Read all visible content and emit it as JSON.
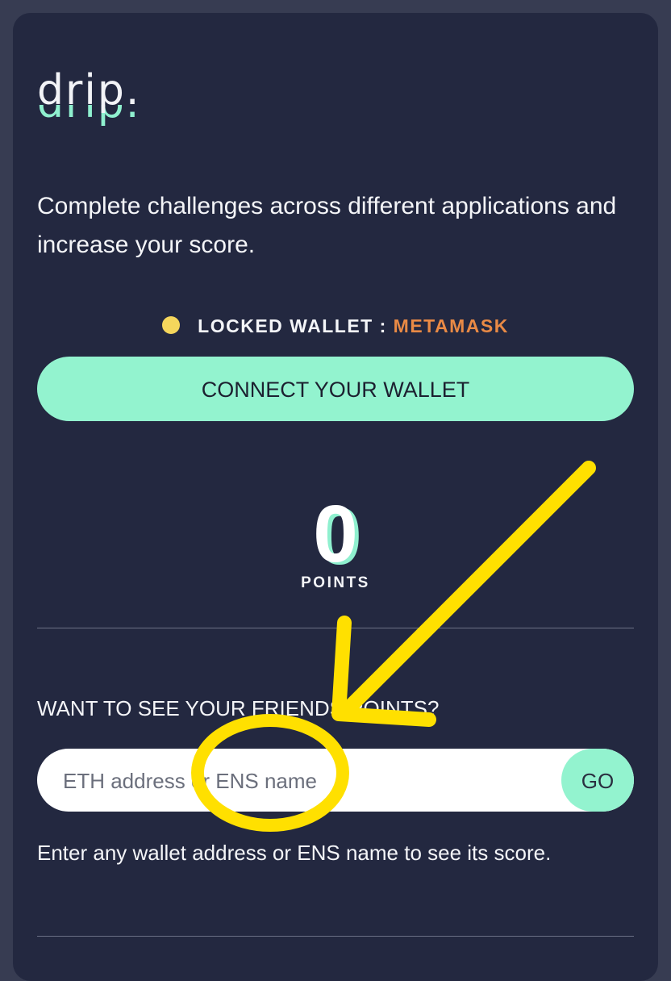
{
  "brand": {
    "logo_text": "drip."
  },
  "intro": {
    "text": "Complete challenges across different applications and increase your score."
  },
  "wallet_status": {
    "label": "LOCKED WALLET :",
    "provider": "METAMASK",
    "indicator_color": "#f5d65c",
    "provider_color": "#e98a45"
  },
  "connect_button": {
    "label": "CONNECT YOUR WALLET"
  },
  "score": {
    "value": "0",
    "label": "POINTS"
  },
  "friend_lookup": {
    "heading": "WANT TO SEE YOUR FRIENDS POINTS?",
    "placeholder": "ETH address or ENS name",
    "go_label": "GO",
    "helper_text": "Enter any wallet address or ENS name to see its score."
  },
  "colors": {
    "background": "#373c52",
    "card": "#232840",
    "accent": "#93f3cf",
    "annotation": "#ffe000"
  },
  "icons": {
    "status_dot": "status-dot-icon"
  }
}
